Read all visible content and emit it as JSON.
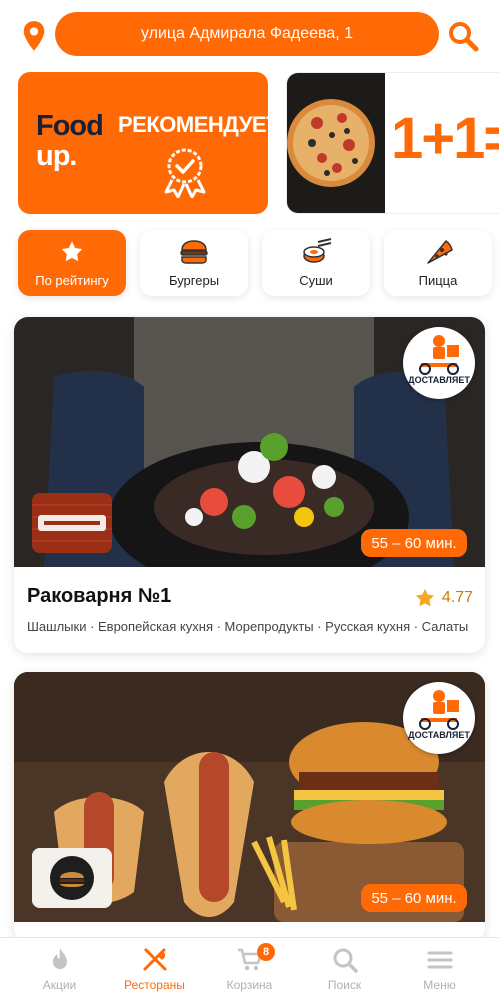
{
  "header": {
    "address": "улица Адмирала Фадеева, 1",
    "icons": [
      "location-pin-icon",
      "search-icon"
    ]
  },
  "banners": {
    "foodup": {
      "brand_top": "Food",
      "brand_bottom": "up.",
      "headline": "РЕКОМЕНДУЕТ"
    },
    "promo": {
      "headline": "1+1="
    }
  },
  "categories": [
    {
      "label": "По рейтингу",
      "icon": "star-icon",
      "active": true
    },
    {
      "label": "Бургеры",
      "icon": "burger-icon",
      "active": false
    },
    {
      "label": "Суши",
      "icon": "sushi-icon",
      "active": false
    },
    {
      "label": "Пицца",
      "icon": "pizza-icon",
      "active": false
    }
  ],
  "restaurants": [
    {
      "name": "Раковарня №1",
      "rating": "4.77",
      "delivery_time": "55 – 60 мин.",
      "delivery_badge": "ДОСТАВЛЯЕТ",
      "cuisines": "Шашлыки · Европейская кухня · Морепродукты · Русская кухня · Салаты"
    },
    {
      "name": "",
      "rating": "",
      "delivery_time": "55 – 60 мин.",
      "delivery_badge": "ДОСТАВЛЯЕТ",
      "cuisines": ""
    }
  ],
  "bottom_nav": {
    "items": [
      {
        "label": "Акции",
        "icon": "flame-icon",
        "active": false
      },
      {
        "label": "Рестораны",
        "icon": "utensils-icon",
        "active": true
      },
      {
        "label": "Корзина",
        "icon": "cart-icon",
        "active": false,
        "badge": "8"
      },
      {
        "label": "Поиск",
        "icon": "search-icon",
        "active": false
      },
      {
        "label": "Меню",
        "icon": "menu-icon",
        "active": false
      }
    ]
  },
  "colors": {
    "accent": "#ff6a06",
    "brand_dark": "#1a2035",
    "rating_star": "#f5a623"
  }
}
